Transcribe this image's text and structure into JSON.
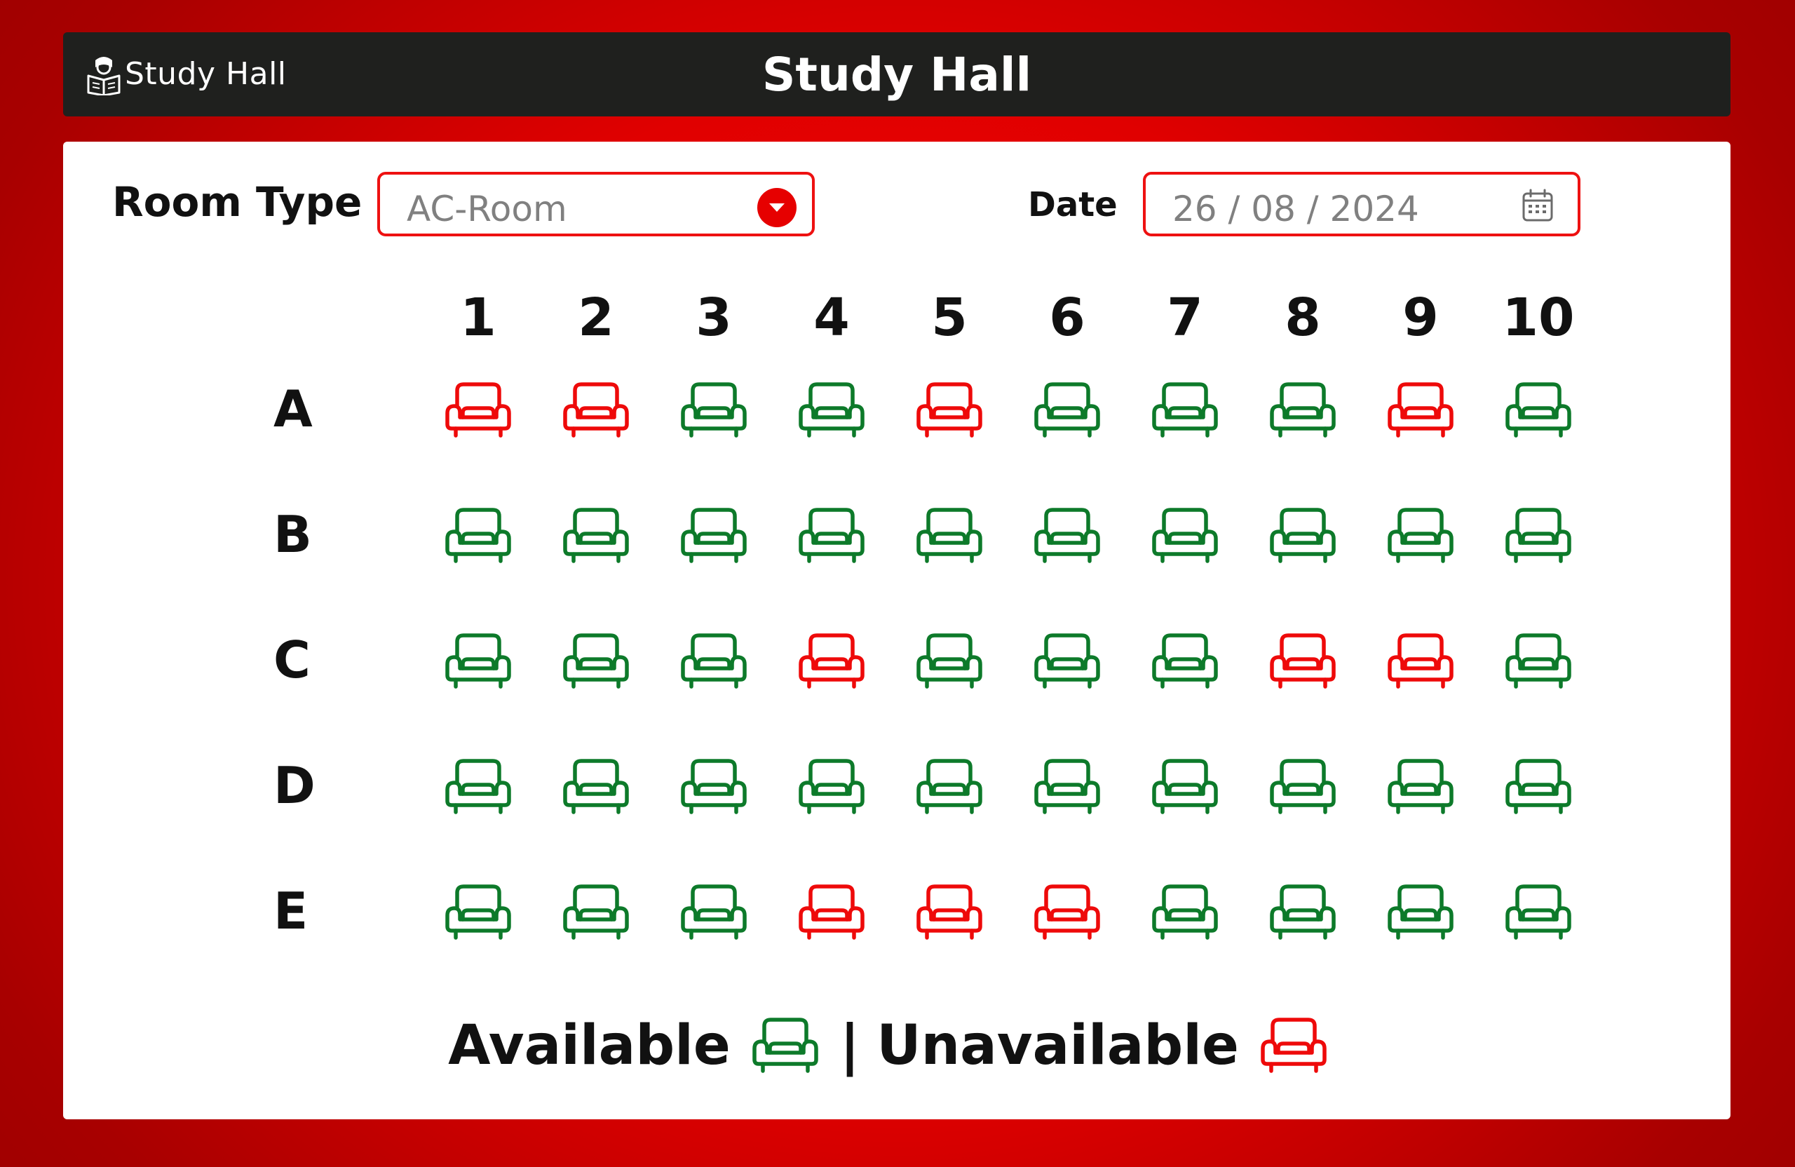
{
  "header": {
    "brand_label": "Study Hall",
    "title": "Study Hall",
    "brand_icon": "reader-icon"
  },
  "form": {
    "room_type_label": "Room Type",
    "room_type_value": "AC-Room",
    "date_label": "Date",
    "date_value": "26 / 08 / 2024",
    "date_icon": "calendar-icon"
  },
  "seating": {
    "columns": [
      "1",
      "2",
      "3",
      "4",
      "5",
      "6",
      "7",
      "8",
      "9",
      "10"
    ],
    "rows": [
      {
        "label": "A",
        "seats": [
          "unavailable",
          "unavailable",
          "available",
          "available",
          "unavailable",
          "available",
          "available",
          "available",
          "unavailable",
          "available"
        ]
      },
      {
        "label": "B",
        "seats": [
          "available",
          "available",
          "available",
          "available",
          "available",
          "available",
          "available",
          "available",
          "available",
          "available"
        ]
      },
      {
        "label": "C",
        "seats": [
          "available",
          "available",
          "available",
          "unavailable",
          "available",
          "available",
          "available",
          "unavailable",
          "unavailable",
          "available"
        ]
      },
      {
        "label": "D",
        "seats": [
          "available",
          "available",
          "available",
          "available",
          "available",
          "available",
          "available",
          "available",
          "available",
          "available"
        ]
      },
      {
        "label": "E",
        "seats": [
          "available",
          "available",
          "available",
          "unavailable",
          "unavailable",
          "unavailable",
          "available",
          "available",
          "available",
          "available"
        ]
      }
    ],
    "seat_icon": "armchair-icon"
  },
  "legend": {
    "available_label": "Available",
    "separator": "|",
    "unavailable_label": "Unavailable"
  },
  "colors": {
    "available": "#0d7a2a",
    "unavailable": "#ee0a0a",
    "accent": "#e60000",
    "header_bg": "#1f201e"
  }
}
